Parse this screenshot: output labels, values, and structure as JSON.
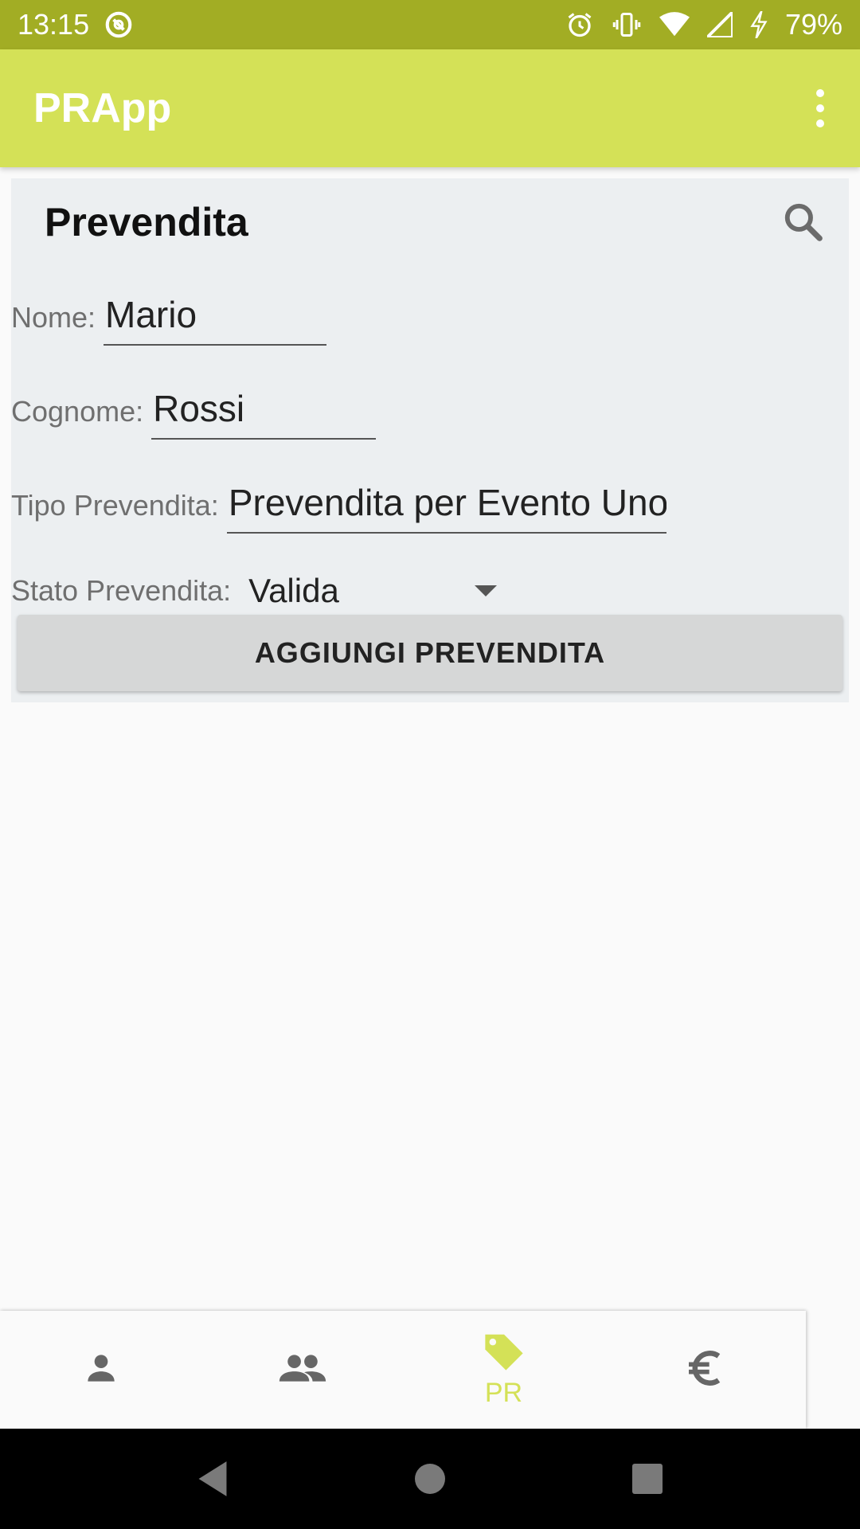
{
  "status_bar": {
    "time": "13:15",
    "battery": "79%",
    "icons": [
      "sync-icon",
      "alarm-icon",
      "vibrate-icon",
      "wifi-icon",
      "signal-icon",
      "charging-icon"
    ]
  },
  "app_bar": {
    "title": "PRApp",
    "menu_icon": "more-vert-icon"
  },
  "form": {
    "title": "Prevendita",
    "search_icon": "search-icon",
    "nome_label": "Nome:",
    "nome_value": "Mario",
    "cognome_label": "Cognome:",
    "cognome_value": "Rossi",
    "tipo_label": "Tipo Prevendita:",
    "tipo_value": "Prevendita per Evento Uno",
    "stato_label": "Stato Prevendita:",
    "stato_value": "Valida",
    "add_button_label": "AGGIUNGI PREVENDITA"
  },
  "bottom_nav": {
    "items": [
      {
        "icon": "person-icon",
        "label": ""
      },
      {
        "icon": "group-icon",
        "label": ""
      },
      {
        "icon": "tag-icon",
        "label": "PR",
        "active": true
      },
      {
        "icon": "euro-icon",
        "label": ""
      }
    ]
  },
  "colors": {
    "status_bar": "#a2ad24",
    "app_bar": "#d4e157",
    "accent": "#d4e157",
    "card_bg": "#eceff1"
  }
}
